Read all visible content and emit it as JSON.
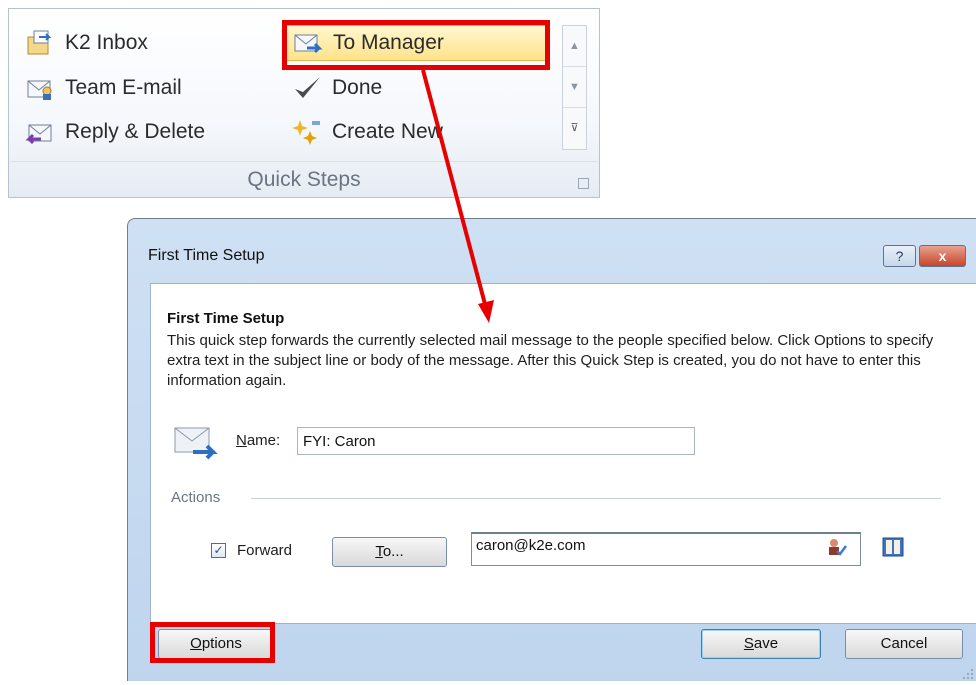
{
  "quick_steps": {
    "items": [
      {
        "label": "K2 Inbox",
        "icon": "folder-move-icon"
      },
      {
        "label": "To Manager",
        "icon": "forward-mail-icon",
        "highlighted": true
      },
      {
        "label": "Team E-mail",
        "icon": "team-mail-icon"
      },
      {
        "label": "Done",
        "icon": "checkmark-icon"
      },
      {
        "label": "Reply & Delete",
        "icon": "reply-delete-icon"
      },
      {
        "label": "Create New",
        "icon": "sparkle-new-icon"
      }
    ],
    "group_label": "Quick Steps",
    "highlight_color": "#ffe38a"
  },
  "annotation": {
    "color": "#e60000"
  },
  "dialog": {
    "window_title": "First Time Setup",
    "help_glyph": "?",
    "close_glyph": "x",
    "heading": "First Time Setup",
    "description": "This quick step forwards the currently selected mail message to the people specified below. Click Options to specify extra text in the subject line or body of the message. After this Quick Step is created, you do not have to enter this information again.",
    "name_label_mnemonic": "N",
    "name_label_rest": "ame:",
    "name_value": "FYI: Caron",
    "actions_label": "Actions",
    "forward_checked": true,
    "forward_label": "Forward",
    "to_button_mnemonic": "T",
    "to_button_rest": "o...",
    "to_value": "caron@k2e.com",
    "options_mnemonic": "O",
    "options_rest": "ptions",
    "save_mnemonic": "S",
    "save_rest": "ave",
    "cancel_label": "Cancel",
    "title_bar_color": "#c6dbf1"
  }
}
